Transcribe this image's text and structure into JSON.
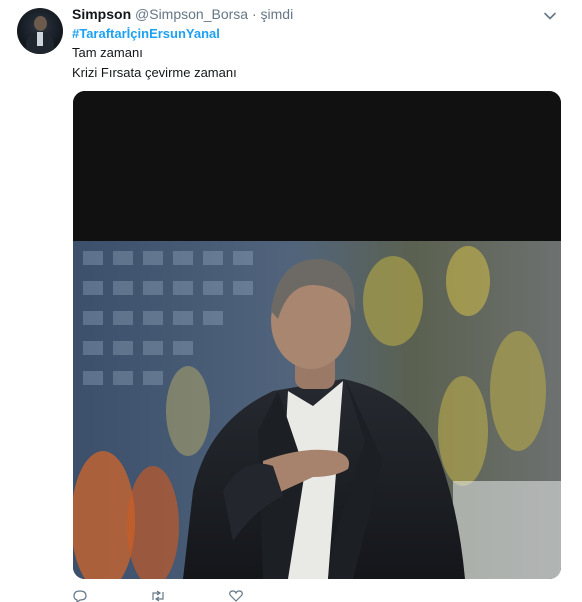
{
  "tweet": {
    "author_name": "Simpson",
    "author_handle": "@Simpson_Borsa",
    "separator": "·",
    "timestamp": "şimdi",
    "hashtag": "#TaraftarİçinErsunYanal",
    "lines": [
      "Tam zamanı",
      "Krizi Fırsata çevirme zamanı"
    ]
  },
  "icons": {
    "menu": "chevron-down-icon",
    "reply": "reply-icon",
    "retweet": "retweet-icon",
    "like": "heart-icon"
  },
  "colors": {
    "link": "#1da1f2",
    "secondary_text": "#657786",
    "primary_text": "#14171a"
  }
}
